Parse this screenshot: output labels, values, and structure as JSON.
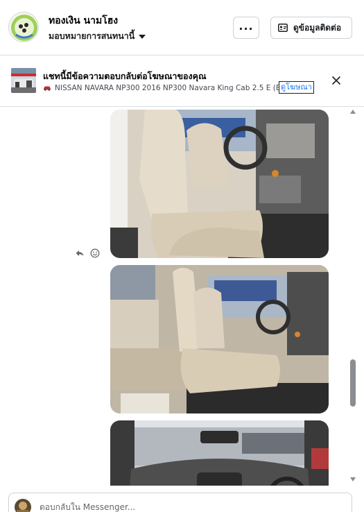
{
  "header": {
    "contact_name": "ทองเงิน นามโฮง",
    "assign_label": "มอบหมายการสนทนานี้",
    "more_label": "...",
    "contact_info_label": "ดูข้อมูลติดต่อ"
  },
  "ad_banner": {
    "title": "แชทนี้มีข้อความตอบกลับต่อโฆษณาของคุณ",
    "subtitle": "NISSAN NAVARA NP300 2016 NP300 Navara King Cab 2.5 E (Ben...",
    "link_label": "ดูโฆษณา"
  },
  "chat": {
    "messages": [
      {
        "type": "image",
        "description_icon": "car-interior-photo"
      },
      {
        "type": "image",
        "description_icon": "car-interior-photo"
      },
      {
        "type": "image",
        "description_icon": "car-dashboard-photo"
      }
    ]
  },
  "composer": {
    "placeholder": "ตอบกลับใน Messenger..."
  },
  "colors": {
    "link": "#1876f2",
    "border": "#dadde1",
    "text": "#050505"
  }
}
